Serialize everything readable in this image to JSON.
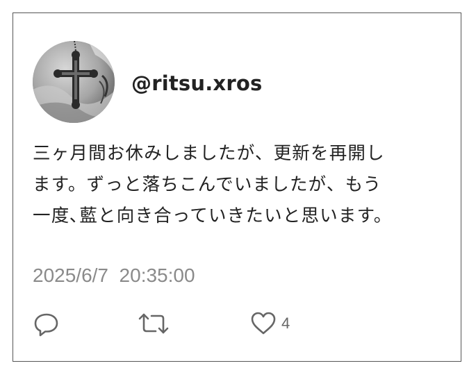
{
  "post": {
    "handle": "@ritsu.xros",
    "avatar_icon": "cross-pendant-avatar",
    "body_lines": [
      "三ヶ月間お休みしましたが、更新を再開し",
      "ます。ずっと落ちこんでいましたが、もう",
      "一度､藍と向き合っていきたいと思います。"
    ],
    "timestamp": "2025/6/7  20:35:00",
    "actions": {
      "reply_icon": "reply-icon",
      "retweet_icon": "retweet-icon",
      "like_icon": "heart-icon",
      "like_count": "4"
    },
    "colors": {
      "border": "#555555",
      "text": "#222222",
      "muted": "#8a8a8a",
      "icon": "#666666"
    }
  }
}
